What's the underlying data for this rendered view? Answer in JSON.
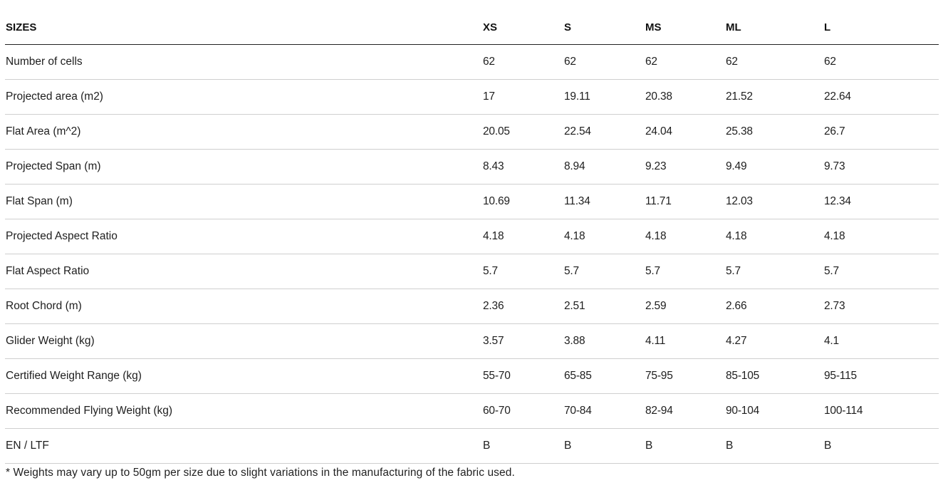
{
  "table": {
    "header": {
      "label": "SIZES",
      "sizes": [
        "XS",
        "S",
        "MS",
        "ML",
        "L"
      ]
    },
    "rows": [
      {
        "label": "Number of cells",
        "values": [
          "62",
          "62",
          "62",
          "62",
          "62"
        ]
      },
      {
        "label": "Projected area (m2)",
        "values": [
          "17",
          "19.11",
          "20.38",
          "21.52",
          "22.64"
        ]
      },
      {
        "label": "Flat Area (m^2)",
        "values": [
          "20.05",
          "22.54",
          "24.04",
          "25.38",
          "26.7"
        ]
      },
      {
        "label": "Projected Span (m)",
        "values": [
          "8.43",
          "8.94",
          "9.23",
          "9.49",
          "9.73"
        ]
      },
      {
        "label": "Flat Span (m)",
        "values": [
          "10.69",
          "11.34",
          "11.71",
          "12.03",
          "12.34"
        ]
      },
      {
        "label": "Projected Aspect Ratio",
        "values": [
          "4.18",
          "4.18",
          "4.18",
          "4.18",
          "4.18"
        ]
      },
      {
        "label": "Flat Aspect Ratio",
        "values": [
          "5.7",
          "5.7",
          "5.7",
          "5.7",
          "5.7"
        ]
      },
      {
        "label": "Root Chord (m)",
        "values": [
          "2.36",
          "2.51",
          "2.59",
          "2.66",
          "2.73"
        ]
      },
      {
        "label": "Glider Weight (kg)",
        "values": [
          "3.57",
          "3.88",
          "4.11",
          "4.27",
          "4.1"
        ]
      },
      {
        "label": "Certified Weight Range (kg)",
        "values": [
          "55-70",
          "65-85",
          "75-95",
          "85-105",
          "95-115"
        ]
      },
      {
        "label": "Recommended Flying Weight (kg)",
        "values": [
          "60-70",
          "70-84",
          "82-94",
          "90-104",
          "100-114"
        ]
      },
      {
        "label": "EN / LTF",
        "values": [
          "B",
          "B",
          "B",
          "B",
          "B"
        ]
      }
    ]
  },
  "footnote": "* Weights may vary up to 50gm per size due to slight variations in the manufacturing of the fabric used."
}
